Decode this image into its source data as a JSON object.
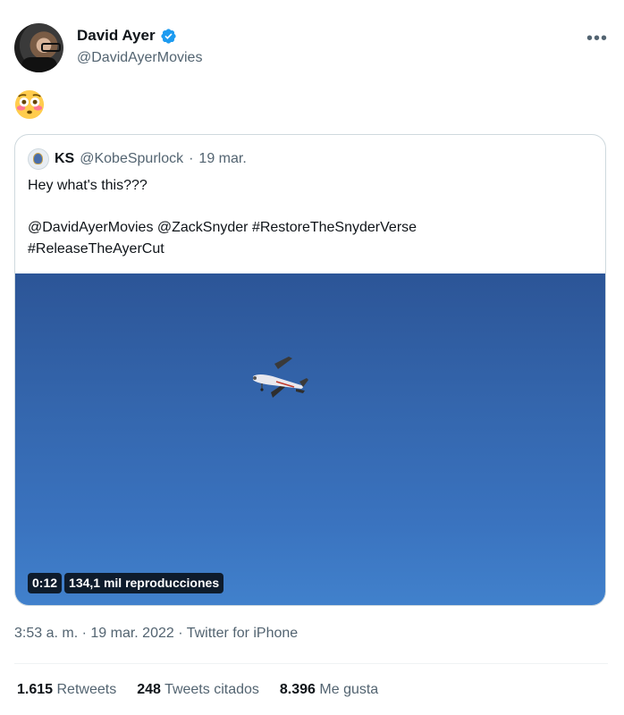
{
  "author": {
    "display_name": "David Ayer",
    "handle": "@DavidAyerMovies",
    "verified_icon": "verified-badge-icon",
    "verified_color": "#1d9bf0"
  },
  "more_icon": "•••",
  "tweet": {
    "emoji": "flushed-face-icon"
  },
  "quoted": {
    "name": "KS",
    "handle": "@KobeSpurlock",
    "separator": "·",
    "date": "19 mar.",
    "line1": "Hey what's this???",
    "line2": "@DavidAyerMovies @ZackSnyder #RestoreTheSnyderVerse",
    "line3": "#ReleaseTheAyerCut",
    "video": {
      "duration": "0:12",
      "views": "134,1 mil reproducciones",
      "sky_color": "#3466ad"
    }
  },
  "meta": "3:53 a. m. · 19 mar. 2022 · Twitter for iPhone",
  "stats": {
    "retweets_count": "1.615",
    "retweets_label": "Retweets",
    "quotes_count": "248",
    "quotes_label": "Tweets citados",
    "likes_count": "8.396",
    "likes_label": "Me gusta"
  }
}
